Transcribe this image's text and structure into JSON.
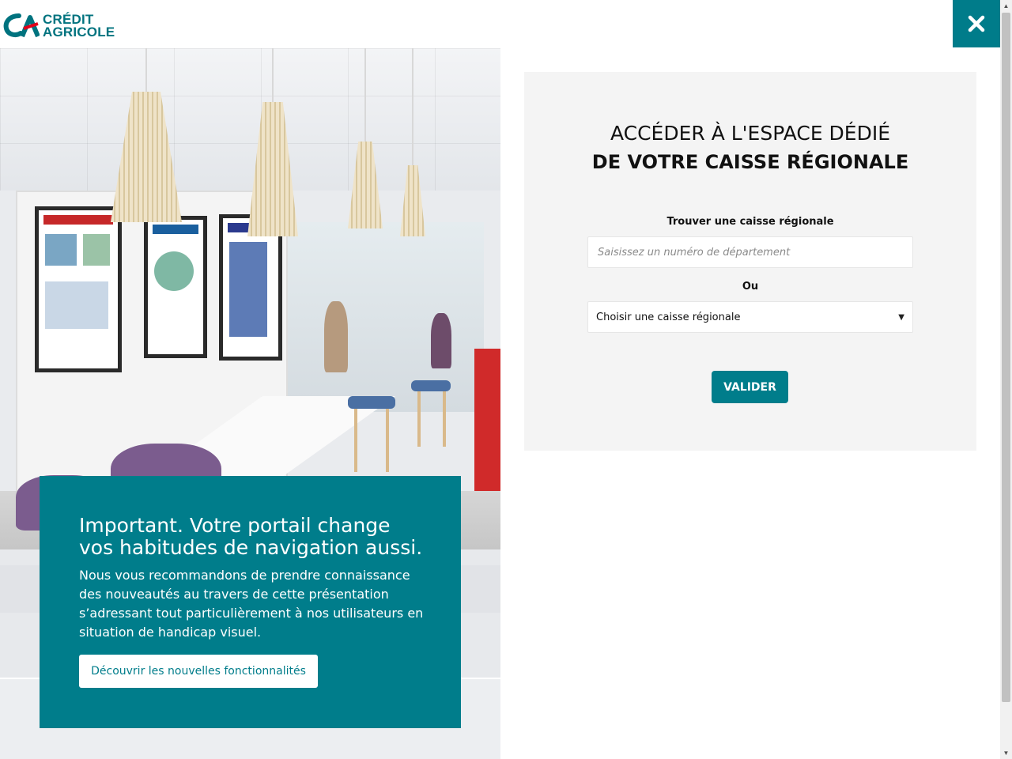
{
  "header": {
    "logo_line1": "CRÉDIT",
    "logo_line2": "AGRICOLE",
    "close_icon": "close-icon"
  },
  "info_card": {
    "title": "Important. Votre portail change vos habitudes de navigation aussi.",
    "text": "Nous vous recommandons de prendre connaissance des nouveautés au travers de cette présentation s’adressant tout particulièrement à nos utilisateurs en situation de handicap visuel.",
    "button_label": "Découvrir les nouvelles fonctionnalités"
  },
  "form": {
    "title_line1": "ACCÉDER À L'ESPACE DÉDIÉ",
    "title_line2": "DE VOTRE CAISSE RÉGIONALE",
    "find_label": "Trouver une caisse régionale",
    "dept_placeholder": "Saisissez un numéro de département",
    "or_label": "Ou",
    "select_value": "Choisir une caisse régionale",
    "submit_label": "VALIDER"
  },
  "colors": {
    "brand_teal": "#007d8b",
    "panel_bg": "#f4f4f4"
  }
}
